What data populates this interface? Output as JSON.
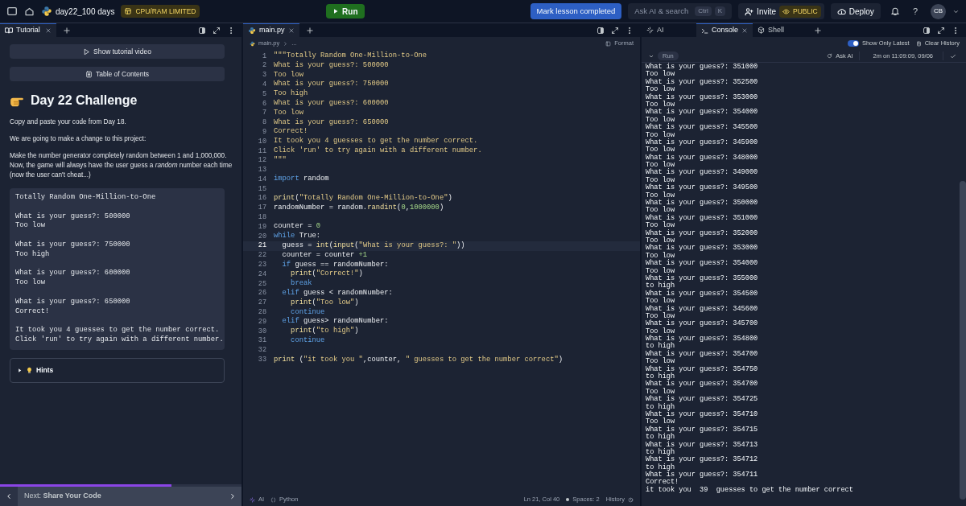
{
  "top_bar": {
    "project": "day22_100 days",
    "badge": "CPU/RAM LIMITED",
    "run": "Run",
    "mark_complete": "Mark lesson completed",
    "search": {
      "placeholder": "Ask AI & search",
      "keys": [
        "Ctrl",
        "K"
      ]
    },
    "invite": "Invite",
    "visibility": "PUBLIC",
    "deploy": "Deploy",
    "help": "?",
    "avatar": "CB"
  },
  "tutorial_pane": {
    "tabs": [
      {
        "label": "Tutorial",
        "selected": true
      }
    ],
    "buttons": [
      {
        "kind": "video",
        "label": "Show tutorial video"
      },
      {
        "kind": "contents",
        "label": "Table of Contents"
      }
    ],
    "heading": "Day 22 Challenge",
    "paragraphs": [
      "Copy and paste your code from Day 18.",
      "We are going to make a change to this project:",
      "Make the number generator completely random between 1 and 1,000,000. Now, the game will always have the user guess a *random* number each time (now the user can't cheat...)"
    ],
    "code_block": [
      [
        "Totally Random One-Million-to-One"
      ],
      [
        "What is your guess?: 500000",
        "Too low"
      ],
      [
        "What is your guess?: 750000",
        "Too high"
      ],
      [
        "What is your guess?: 600000",
        "Too low"
      ],
      [
        "What is your guess?: 650000",
        "Correct!"
      ],
      [
        "It took you 4 guesses to get the number correct.",
        "Click 'run' to try again with a different number."
      ]
    ],
    "hints": {
      "label": "Hints",
      "expanded": false
    },
    "progress": {
      "level": 0.71
    },
    "next": "Next: **Share Your Code**"
  },
  "editor_pane": {
    "tabs": [
      {
        "label": "main.py",
        "selected": true
      }
    ],
    "breadcrumb": [
      "main.py",
      "..."
    ],
    "format": "Format",
    "lines": [
      {
        "n": "1",
        "selected": false,
        "tokens": [
          {
            "kind": "string",
            "text": "\"\"\"Totally Random One-Million-to-One"
          }
        ]
      },
      {
        "n": "2",
        "selected": false,
        "tokens": [
          {
            "kind": "string",
            "text": "What is your guess?: 500000"
          }
        ]
      },
      {
        "n": "3",
        "selected": false,
        "tokens": [
          {
            "kind": "string",
            "text": "Too low"
          }
        ]
      },
      {
        "n": "4",
        "selected": false,
        "tokens": [
          {
            "kind": "string",
            "text": "What is your guess?: 750000"
          }
        ]
      },
      {
        "n": "5",
        "selected": false,
        "tokens": [
          {
            "kind": "string",
            "text": "Too high"
          }
        ]
      },
      {
        "n": "6",
        "selected": false,
        "tokens": [
          {
            "kind": "string",
            "text": "What is your guess?: 600000"
          }
        ]
      },
      {
        "n": "7",
        "selected": false,
        "tokens": [
          {
            "kind": "string",
            "text": "Too low"
          }
        ]
      },
      {
        "n": "8",
        "selected": false,
        "tokens": [
          {
            "kind": "string",
            "text": "What is your guess?: 650000"
          }
        ]
      },
      {
        "n": "9",
        "selected": false,
        "tokens": [
          {
            "kind": "string",
            "text": "Correct!"
          }
        ]
      },
      {
        "n": "10",
        "selected": false,
        "tokens": [
          {
            "kind": "string",
            "text": "It took you 4 guesses to get the number correct."
          }
        ]
      },
      {
        "n": "11",
        "selected": false,
        "tokens": [
          {
            "kind": "string",
            "text": "Click 'run' to try again with a different number."
          }
        ]
      },
      {
        "n": "12",
        "selected": false,
        "tokens": [
          {
            "kind": "string",
            "text": "\"\"\""
          }
        ]
      },
      {
        "n": "13",
        "selected": false
      },
      {
        "n": "14",
        "selected": false,
        "tokens": [
          {
            "kind": "keyword",
            "text": "import"
          },
          {
            "kind": "plain",
            "text": " random"
          }
        ]
      },
      {
        "n": "15",
        "selected": false
      },
      {
        "n": "16",
        "selected": false,
        "tokens": [
          {
            "kind": "function",
            "text": "print"
          },
          {
            "kind": "plain",
            "text": "("
          },
          {
            "kind": "string",
            "text": "\"Totally Random One-Million-to-One\""
          },
          {
            "kind": "plain",
            "text": ")"
          }
        ]
      },
      {
        "n": "17",
        "selected": false,
        "tokens": [
          {
            "kind": "plain",
            "text": "randomNumber = random."
          },
          {
            "kind": "function",
            "text": "randint"
          },
          {
            "kind": "plain",
            "text": "("
          },
          {
            "kind": "number",
            "text": "0"
          },
          {
            "kind": "plain",
            "text": ","
          },
          {
            "kind": "number",
            "text": "1000000"
          },
          {
            "kind": "plain",
            "text": ")"
          }
        ]
      },
      {
        "n": "18",
        "selected": false
      },
      {
        "n": "19",
        "selected": false,
        "tokens": [
          {
            "kind": "plain",
            "text": "counter = "
          },
          {
            "kind": "number",
            "text": "0"
          }
        ]
      },
      {
        "n": "20",
        "selected": false,
        "tokens": [
          {
            "kind": "keyword",
            "text": "while"
          },
          {
            "kind": "plain",
            "text": " True:"
          }
        ]
      },
      {
        "n": "21",
        "selected": true,
        "tokens": [
          {
            "kind": "plain",
            "text": "  guess = "
          },
          {
            "kind": "function",
            "text": "int"
          },
          {
            "kind": "plain",
            "text": "("
          },
          {
            "kind": "function",
            "text": "input"
          },
          {
            "kind": "plain",
            "text": "("
          },
          {
            "kind": "string",
            "text": "\"What is your guess?: \""
          },
          {
            "kind": "plain",
            "text": "))"
          }
        ]
      },
      {
        "n": "22",
        "selected": false,
        "tokens": [
          {
            "kind": "plain",
            "text": "  counter = counter "
          },
          {
            "kind": "number",
            "text": "+1"
          }
        ]
      },
      {
        "n": "23",
        "selected": false,
        "tokens": [
          {
            "kind": "keyword",
            "text": "  if"
          },
          {
            "kind": "plain",
            "text": " guess == randomNumber:"
          }
        ]
      },
      {
        "n": "24",
        "selected": false,
        "tokens": [
          {
            "kind": "function",
            "text": "    print"
          },
          {
            "kind": "plain",
            "text": "("
          },
          {
            "kind": "string",
            "text": "\"Correct!\""
          },
          {
            "kind": "plain",
            "text": ")"
          }
        ]
      },
      {
        "n": "25",
        "selected": false,
        "tokens": [
          {
            "kind": "keyword",
            "text": "    break"
          }
        ]
      },
      {
        "n": "26",
        "selected": false,
        "tokens": [
          {
            "kind": "keyword",
            "text": "  elif"
          },
          {
            "kind": "plain",
            "text": " guess < randomNumber:"
          }
        ]
      },
      {
        "n": "27",
        "selected": false,
        "tokens": [
          {
            "kind": "function",
            "text": "    print"
          },
          {
            "kind": "plain",
            "text": "("
          },
          {
            "kind": "string",
            "text": "\"Too low\""
          },
          {
            "kind": "plain",
            "text": ")"
          }
        ]
      },
      {
        "n": "28",
        "selected": false,
        "tokens": [
          {
            "kind": "keyword",
            "text": "    continue"
          }
        ]
      },
      {
        "n": "29",
        "selected": false,
        "tokens": [
          {
            "kind": "keyword",
            "text": "  elif"
          },
          {
            "kind": "plain",
            "text": " guess> randomNumber:"
          }
        ]
      },
      {
        "n": "30",
        "selected": false,
        "tokens": [
          {
            "kind": "function",
            "text": "    print"
          },
          {
            "kind": "plain",
            "text": "("
          },
          {
            "kind": "string",
            "text": "\"to high\""
          },
          {
            "kind": "plain",
            "text": ")"
          }
        ]
      },
      {
        "n": "31",
        "selected": false,
        "tokens": [
          {
            "kind": "keyword",
            "text": "    continue"
          }
        ]
      },
      {
        "n": "32",
        "selected": false
      },
      {
        "n": "33",
        "selected": false,
        "tokens": [
          {
            "kind": "function",
            "text": "print"
          },
          {
            "kind": "plain",
            "text": " ("
          },
          {
            "kind": "string",
            "text": "\"it took you \""
          },
          {
            "kind": "plain",
            "text": ",counter, "
          },
          {
            "kind": "string",
            "text": "\" guesses to get the number correct\""
          },
          {
            "kind": "plain",
            "text": ")"
          }
        ]
      }
    ],
    "status_bar": {
      "ai": "AI",
      "language": "Python",
      "cursor": "Ln 21, Col 40",
      "spaces": "Spaces: 2",
      "history": "History"
    }
  },
  "console_pane": {
    "tabs": [
      {
        "kind": "ai",
        "label": "AI",
        "selected": false
      },
      {
        "kind": "console",
        "label": "Console",
        "selected": true
      },
      {
        "kind": "shell",
        "label": "Shell",
        "selected": false
      }
    ],
    "show_only_latest": {
      "label": "Show Only Latest",
      "on": true
    },
    "clear_history": "Clear History",
    "run": {
      "label": "Run",
      "ask_ai": "Ask AI",
      "timestamp": "2m on 11:09:09, 09/06"
    },
    "output": [
      "What is your guess?: 351000",
      "Too low",
      "What is your guess?: 352500",
      "Too low",
      "What is your guess?: 353000",
      "Too low",
      "What is your guess?: 354000",
      "Too low",
      "What is your guess?: 345500",
      "Too low",
      "What is your guess?: 345900",
      "Too low",
      "What is your guess?: 348000",
      "Too low",
      "What is your guess?: 349000",
      "Too low",
      "What is your guess?: 349500",
      "Too low",
      "What is your guess?: 350000",
      "Too low",
      "What is your guess?: 351000",
      "Too low",
      "What is your guess?: 352000",
      "Too low",
      "What is your guess?: 353000",
      "Too low",
      "What is your guess?: 354000",
      "Too low",
      "What is your guess?: 355000",
      "to high",
      "What is your guess?: 354500",
      "Too low",
      "What is your guess?: 345600",
      "Too low",
      "What is your guess?: 345700",
      "Too low",
      "What is your guess?: 354800",
      "to high",
      "What is your guess?: 354700",
      "Too low",
      "What is your guess?: 354750",
      "to high",
      "What is your guess?: 354700",
      "Too low",
      "What is your guess?: 354725",
      "to high",
      "What is your guess?: 354710",
      "Too low",
      "What is your guess?: 354715",
      "to high",
      "What is your guess?: 354713",
      "to high",
      "What is your guess?: 354712",
      "to high",
      "What is your guess?: 354711",
      "Correct!",
      "it took you  39  guesses to get the number correct"
    ]
  }
}
